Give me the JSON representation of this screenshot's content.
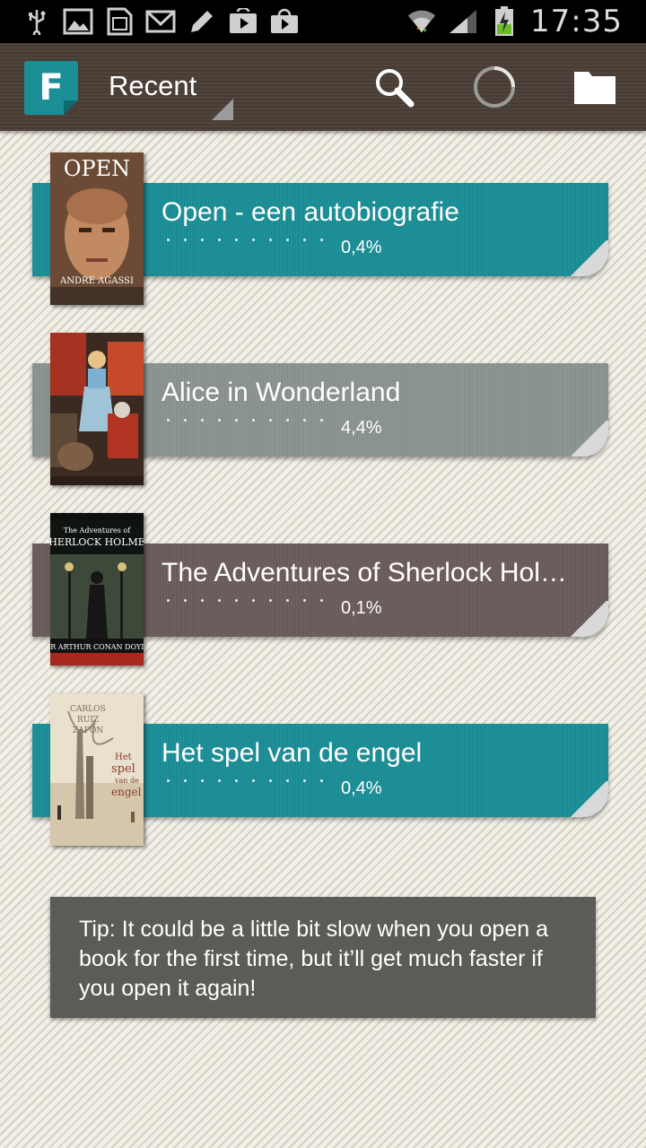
{
  "status_bar": {
    "time": "17:35",
    "icons": [
      "usb-icon",
      "image-icon",
      "sd-card-icon",
      "mail-icon",
      "pencil-icon",
      "play-store-icon",
      "shopping-bag-icon",
      "wifi-icon",
      "signal-icon",
      "battery-charging-icon"
    ]
  },
  "action_bar": {
    "app_initial": "F",
    "nav_title": "Recent",
    "actions": [
      "search-icon",
      "sync-progress-icon",
      "folder-icon"
    ]
  },
  "books": [
    {
      "title": "Open - een autobiografie",
      "progress": "0,4%",
      "ribbon_color": "#1b8f98",
      "cover_title": "OPEN",
      "cover_author": "ANDRE AGASSI"
    },
    {
      "title": "Alice in Wonderland",
      "progress": "4,4%",
      "ribbon_color": "#8c9591",
      "cover_title": "",
      "cover_author": ""
    },
    {
      "title": "The Adventures of Sherlock Hol…",
      "progress": "0,1%",
      "ribbon_color": "#6b5d5b",
      "cover_title": "The Adventures of SHERLOCK HOLMES",
      "cover_author": "SIR ARTHUR CONAN DOYLE"
    },
    {
      "title": "Het spel van de engel",
      "progress": "0,4%",
      "ribbon_color": "#1b8f98",
      "cover_title": "Het spel van de engel",
      "cover_author": "CARLOS RUIZ ZAFÓN"
    }
  ],
  "tip": {
    "text": "Tip: It could be a little bit slow when you open a book for the first time, but it’ll get much faster if you open it again!"
  }
}
